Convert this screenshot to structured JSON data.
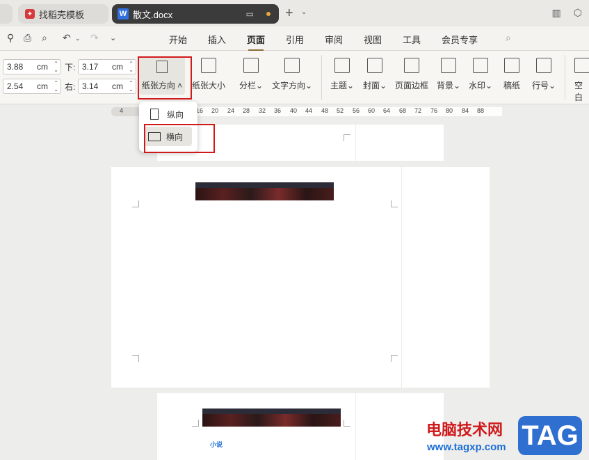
{
  "tabs": {
    "template_label": "找稻壳模板",
    "doc_label": "散文.docx",
    "doc_icon": "W"
  },
  "menu": [
    "开始",
    "插入",
    "页面",
    "引用",
    "审阅",
    "视图",
    "工具",
    "会员专享"
  ],
  "active_menu": "页面",
  "margins": {
    "top_value": "3.88",
    "bottom_label": "下:",
    "bottom_value": "3.17",
    "left_value": "2.54",
    "right_label": "右:",
    "right_value": "3.14",
    "unit": "cm"
  },
  "ribbon": {
    "orientation": "纸张方向",
    "size": "纸张大小",
    "columns": "分栏",
    "text_direction": "文字方向",
    "theme": "主题",
    "cover": "封面",
    "page_border": "页面边框",
    "background": "背景",
    "watermark": "水印",
    "manuscript": "稿纸",
    "line_number": "行号",
    "blank": "空白"
  },
  "dropdown": {
    "portrait": "纵向",
    "landscape": "横向"
  },
  "ruler_ticks": [
    "4",
    "16",
    "20",
    "24",
    "28",
    "32",
    "36",
    "40",
    "44",
    "48",
    "52",
    "56",
    "60",
    "64",
    "68",
    "72",
    "76",
    "80",
    "84",
    "88"
  ],
  "page3_text": "小说",
  "watermark": {
    "site_name": "电脑技术网",
    "site_url": "www.tagxp.com",
    "badge": "TAG"
  },
  "colors": {
    "highlight_red": "#d0191b",
    "accent_blue": "#2f6fd0"
  }
}
